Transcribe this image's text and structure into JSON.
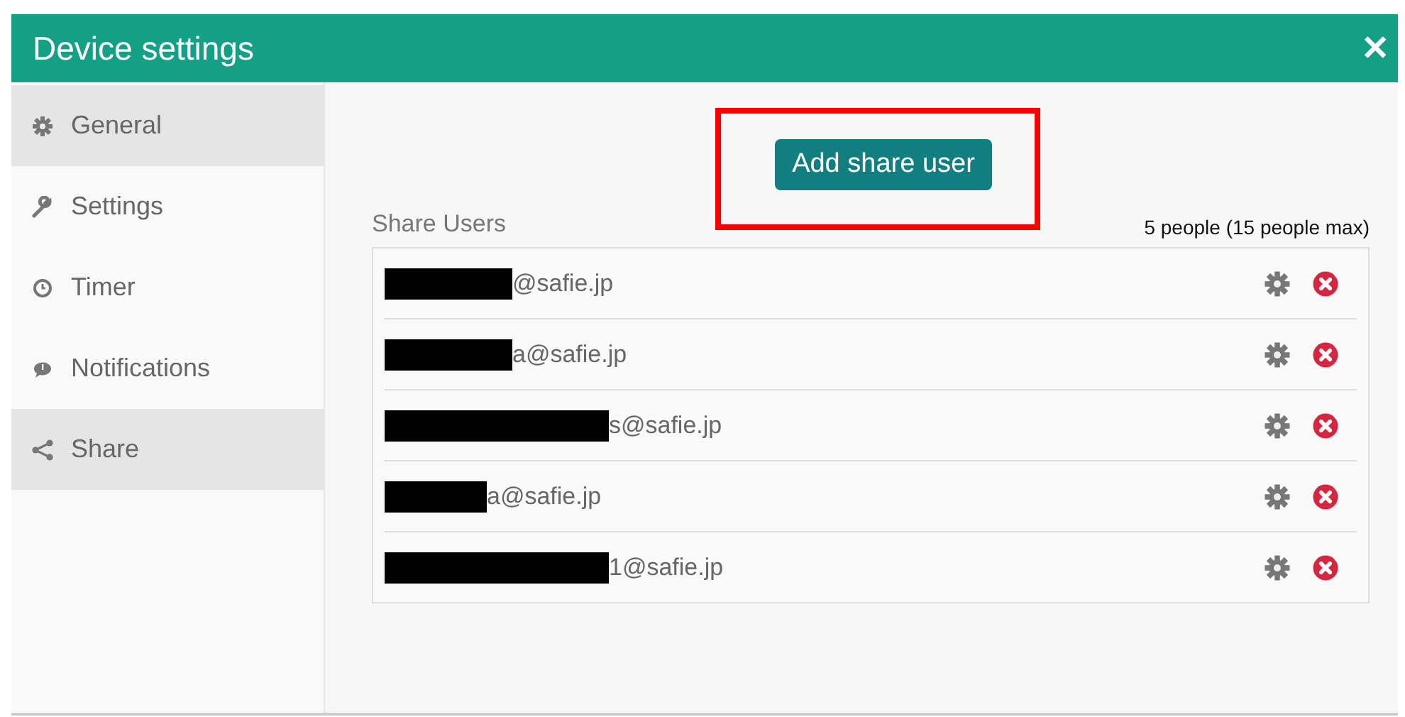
{
  "window": {
    "title": "Device settings",
    "close": "✕"
  },
  "sidebar": {
    "items": [
      {
        "label": "General",
        "selected": true
      },
      {
        "label": "Settings",
        "selected": false
      },
      {
        "label": "Timer",
        "selected": false
      },
      {
        "label": "Notifications",
        "selected": false
      },
      {
        "label": "Share",
        "selected": true
      }
    ]
  },
  "add_button": {
    "label": "Add share user",
    "highlighted": true
  },
  "share_users": {
    "heading": "Share Users",
    "count": "5 people (15 people max)",
    "users": [
      {
        "email": "@safie.jp",
        "redacted": true
      },
      {
        "email": "a@safie.jp",
        "redacted": true
      },
      {
        "email": "s@safie.jp",
        "redacted": true
      },
      {
        "email": "a@safie.jp",
        "redacted": true
      },
      {
        "email": "1@safie.jp",
        "redacted": true
      }
    ]
  }
}
